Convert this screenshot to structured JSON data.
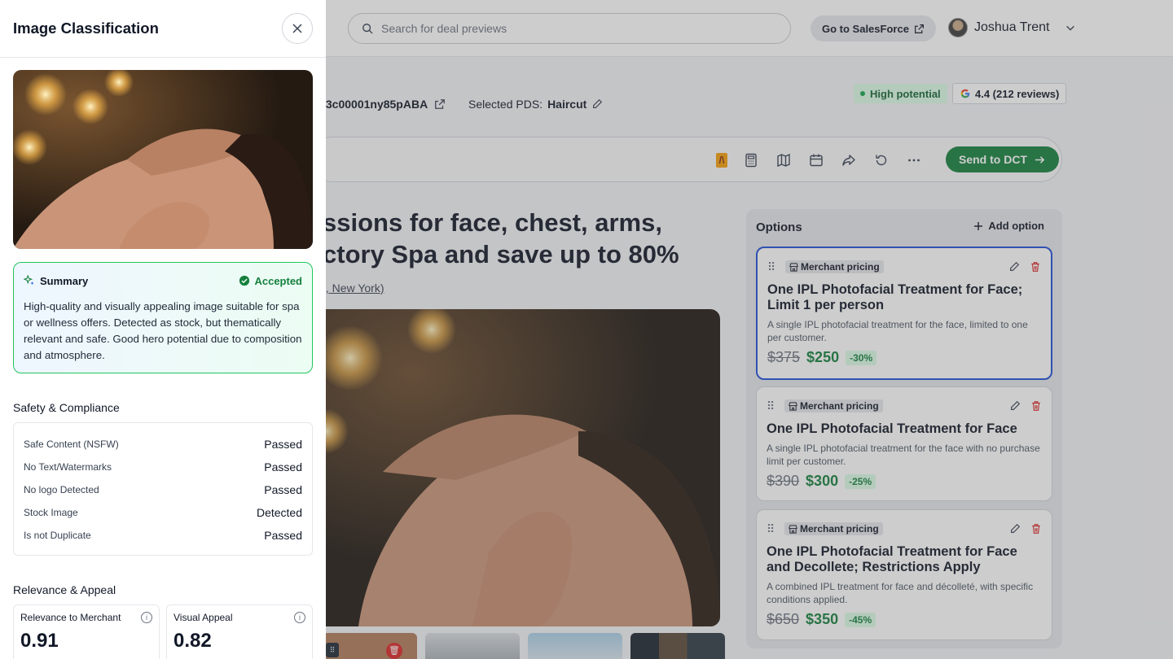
{
  "header": {
    "search_placeholder": "Search for deal previews",
    "salesforce_label": "Go to SalesForce",
    "user_name": "Joshua Trent"
  },
  "deal": {
    "id_fragment": ".3c00001ny85pABA",
    "pds_label": "Selected PDS:",
    "pds_value": "Haircut",
    "potential_badge": "High potential",
    "rating_badge": "4.4 (212 reviews)",
    "title_line1": "ssions for face, chest, arms,",
    "title_line2": "ctory Spa and save up to 80%",
    "location_fragment": "t, New York)"
  },
  "toolbar": {
    "send_label": "Send to DCT",
    "icons": [
      "brand-icon",
      "calculator-icon",
      "map-icon",
      "calendar-icon",
      "share-icon",
      "refresh-icon",
      "more-icon"
    ]
  },
  "options": {
    "heading": "Options",
    "add_label": "Add option",
    "items": [
      {
        "badge": "Merchant pricing",
        "title": "One IPL Photofacial Treatment for Face; Limit 1 per person",
        "desc": "A single IPL photofacial treatment for the face, limited to one per customer.",
        "old_price": "$375",
        "new_price": "$250",
        "discount": "-30%"
      },
      {
        "badge": "Merchant pricing",
        "title": "One IPL Photofacial Treatment for Face",
        "desc": "A single IPL photofacial treatment for the face with no purchase limit per customer.",
        "old_price": "$390",
        "new_price": "$300",
        "discount": "-25%"
      },
      {
        "badge": "Merchant pricing",
        "title": "One IPL Photofacial Treatment for Face and Decollete; Restrictions Apply",
        "desc": "A combined IPL treatment for face and décolleté, with specific conditions applied.",
        "old_price": "$650",
        "new_price": "$350",
        "discount": "-45%"
      }
    ]
  },
  "panel": {
    "title": "Image Classification",
    "summary": {
      "label": "Summary",
      "status": "Accepted",
      "text": "High-quality and visually appealing image suitable for spa or wellness offers. Detected as stock, but thematically relevant and safe. Good hero potential due to composition and atmosphere."
    },
    "safety_title": "Safety & Compliance",
    "checks": [
      {
        "label": "Safe Content (NSFW)",
        "value": "Passed"
      },
      {
        "label": "No Text/Watermarks",
        "value": "Passed"
      },
      {
        "label": "No logo Detected",
        "value": "Passed"
      },
      {
        "label": "Stock Image",
        "value": "Detected"
      },
      {
        "label": "Is not Duplicate",
        "value": "Passed"
      }
    ],
    "relevance_title": "Relevance & Appeal",
    "metrics": [
      {
        "label": "Relevance to Merchant",
        "value": "0.91"
      },
      {
        "label": "Visual Appeal",
        "value": "0.82"
      }
    ]
  },
  "colors": {
    "accent_green": "#15803d",
    "selected_border": "#1d4ed8",
    "delete_red": "#dc2626"
  }
}
